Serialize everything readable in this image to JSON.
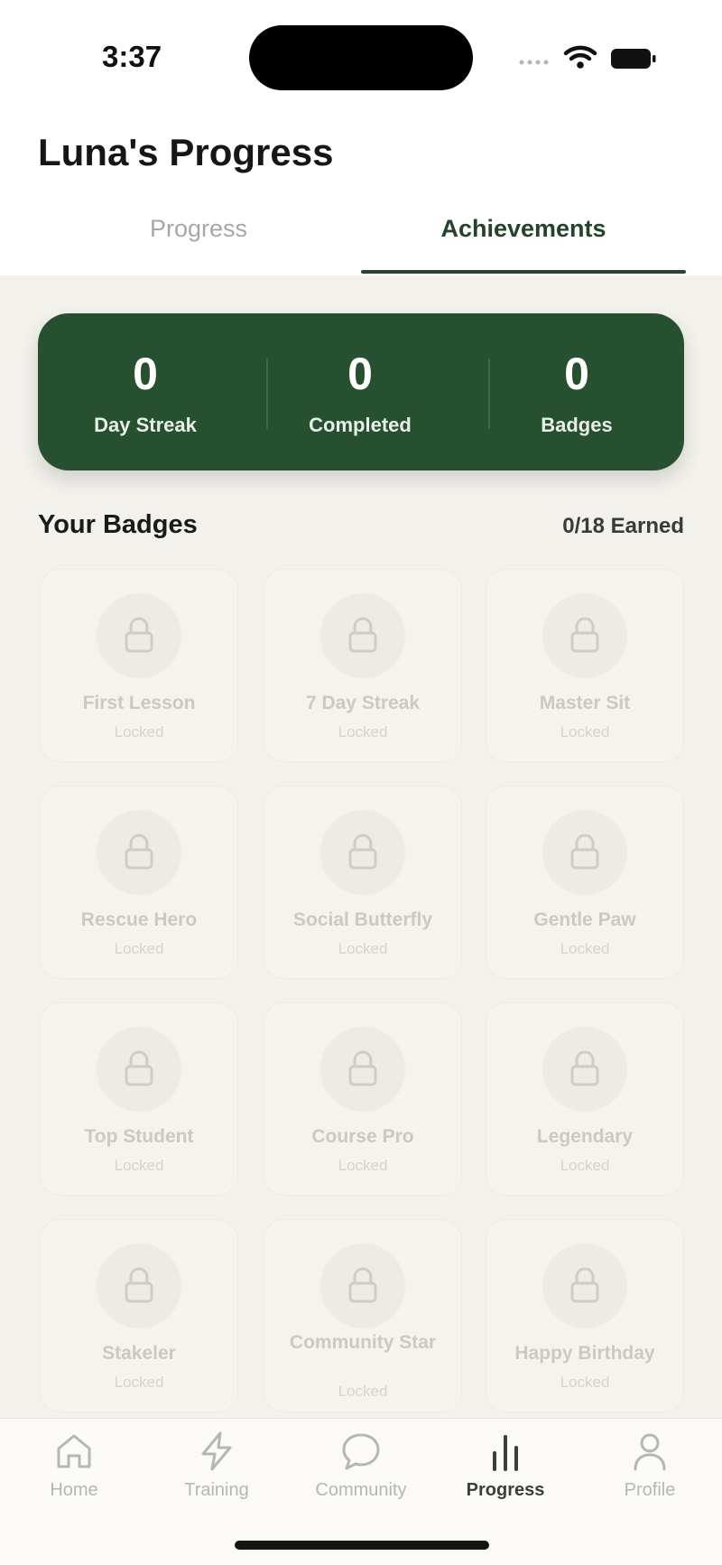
{
  "status_bar": {
    "time": "3:37"
  },
  "header": {
    "title": "Luna's Progress"
  },
  "tabs": [
    {
      "label": "Progress",
      "active": false
    },
    {
      "label": "Achievements",
      "active": true
    }
  ],
  "stats": [
    {
      "value": "0",
      "label": "Day Streak"
    },
    {
      "value": "0",
      "label": "Completed"
    },
    {
      "value": "0",
      "label": "Badges"
    }
  ],
  "badges_section": {
    "title": "Your Badges",
    "earned": "0/18 Earned"
  },
  "badges": [
    {
      "name": "First Lesson",
      "status": "Locked",
      "icon": "lock-icon"
    },
    {
      "name": "7 Day Streak",
      "status": "Locked",
      "icon": "lock-icon"
    },
    {
      "name": "Master Sit",
      "status": "Locked",
      "icon": "lock-icon"
    },
    {
      "name": "Rescue Hero",
      "status": "Locked",
      "icon": "lock-icon"
    },
    {
      "name": "Social Butterfly",
      "status": "Locked",
      "icon": "lock-icon"
    },
    {
      "name": "Gentle Paw",
      "status": "Locked",
      "icon": "lock-icon"
    },
    {
      "name": "Top Student",
      "status": "Locked",
      "icon": "lock-icon"
    },
    {
      "name": "Course Pro",
      "status": "Locked",
      "icon": "lock-icon"
    },
    {
      "name": "Legendary",
      "status": "Locked",
      "icon": "lock-icon"
    },
    {
      "name": "Stakeler",
      "status": "Locked",
      "icon": "lock-icon"
    },
    {
      "name": "Community Star",
      "status": "Locked",
      "icon": "lock-icon"
    },
    {
      "name": "Happy Birthday",
      "status": "Locked",
      "icon": "lock-icon"
    }
  ],
  "tabbar": [
    {
      "label": "Home",
      "icon": "home-icon",
      "active": false
    },
    {
      "label": "Training",
      "icon": "lightning-icon",
      "active": false
    },
    {
      "label": "Community",
      "icon": "chat-bubble-icon",
      "active": false
    },
    {
      "label": "Progress",
      "icon": "bar-chart-icon",
      "active": true
    },
    {
      "label": "Profile",
      "icon": "person-icon",
      "active": false
    }
  ],
  "colors": {
    "accent_green": "#26502f",
    "background": "#f3f1ec"
  }
}
